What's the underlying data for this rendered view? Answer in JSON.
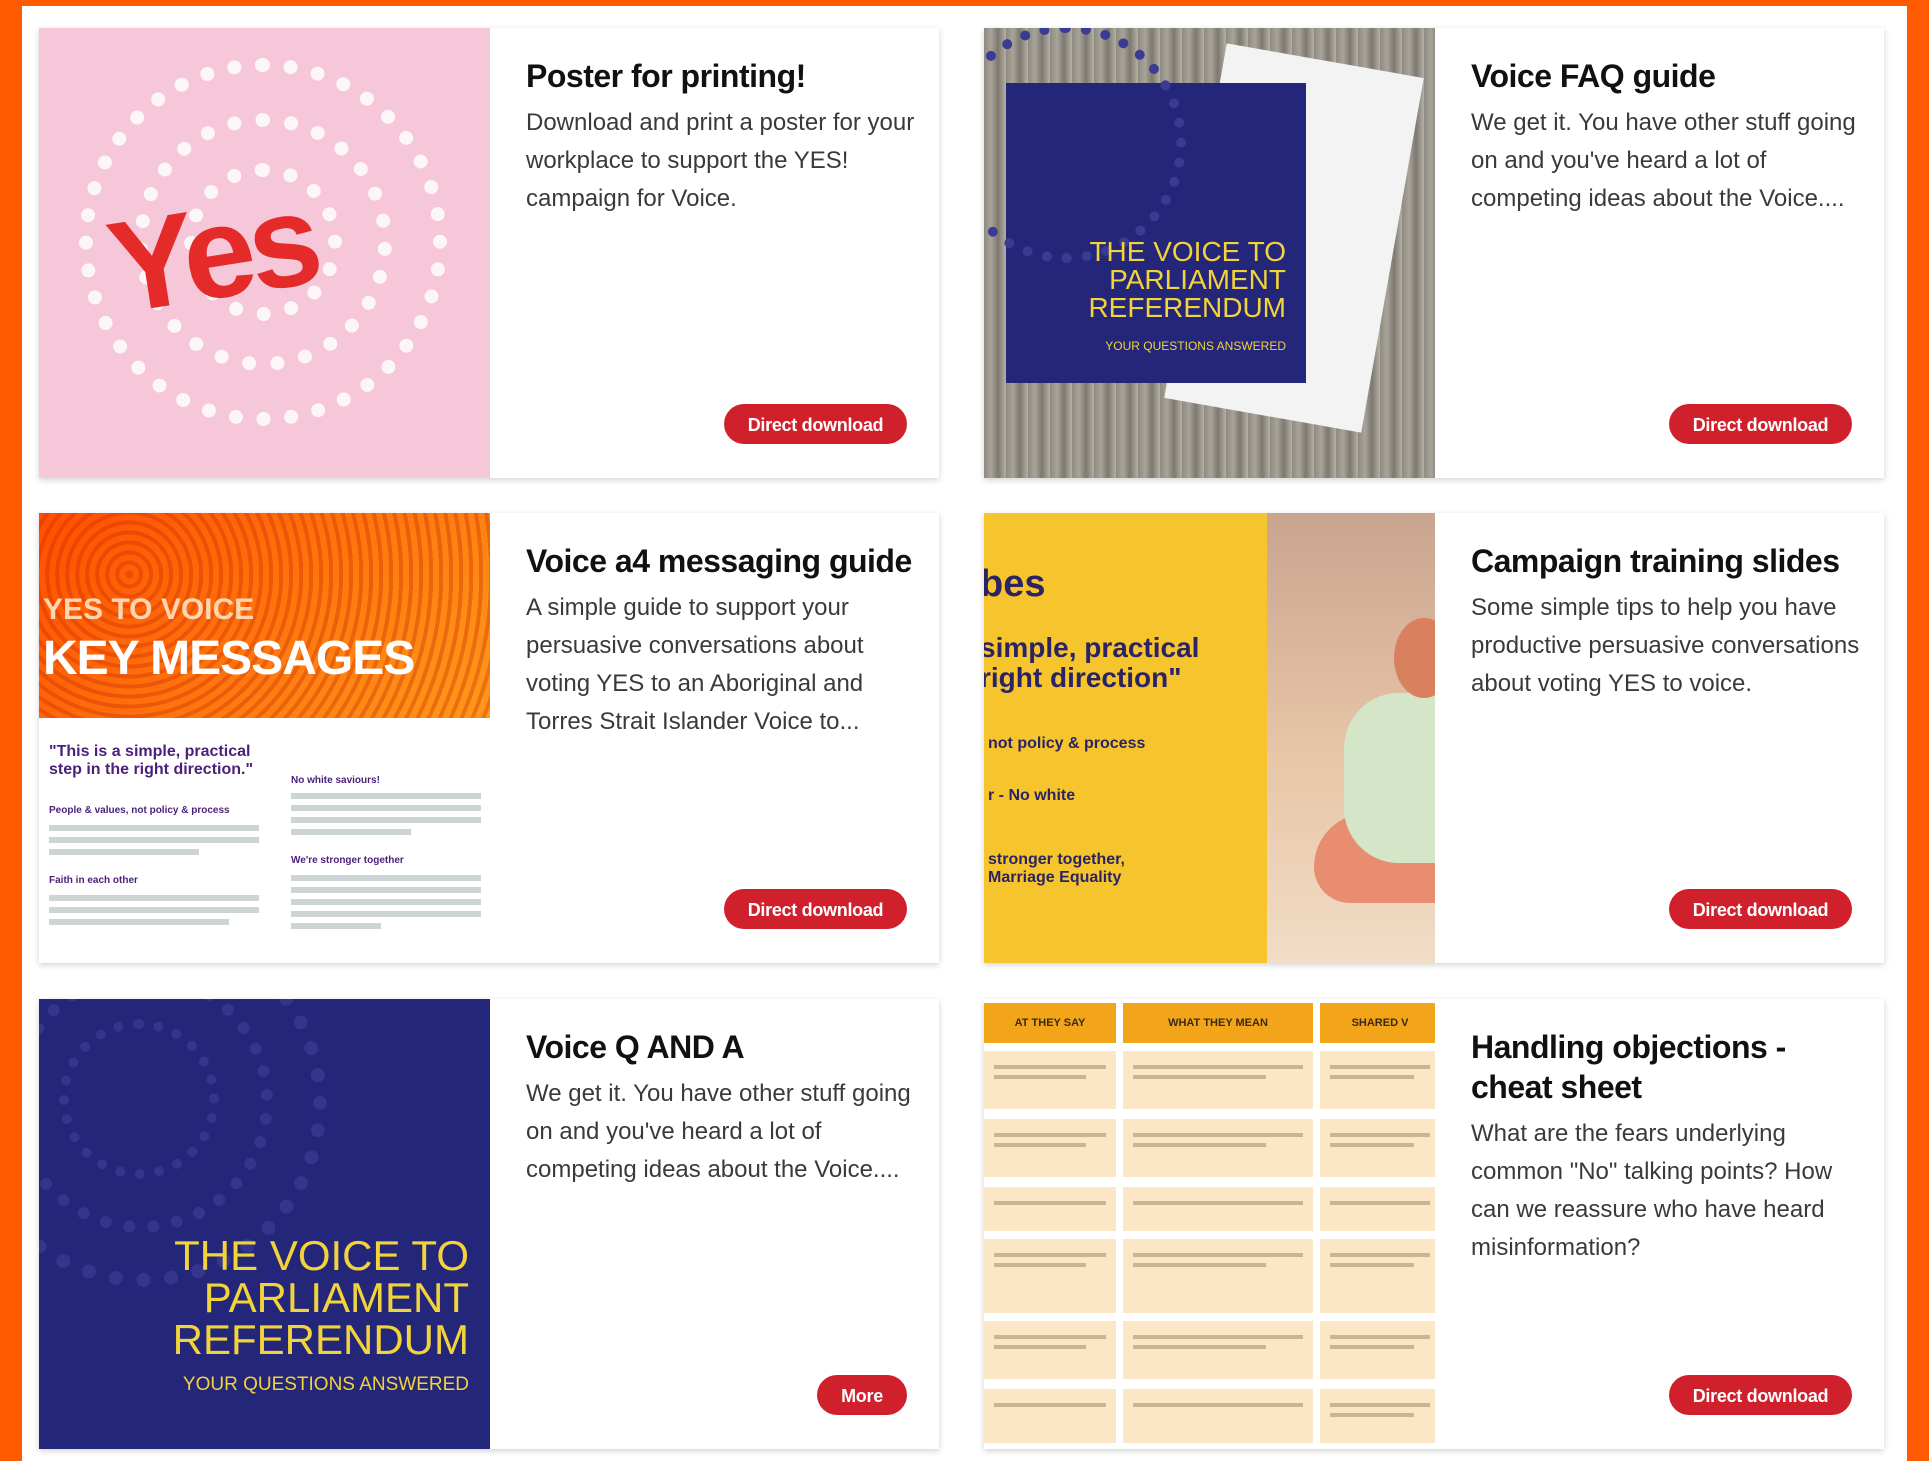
{
  "cards": [
    {
      "title": "Poster for printing!",
      "description": "Download and print a poster for your workplace to support the YES! campaign for Voice.",
      "button": "Direct download",
      "thumb_text": "Yes"
    },
    {
      "title": "Voice FAQ guide",
      "description": "We get it. You have other stuff going on and you've heard a lot of competing ideas about the Voice....",
      "button": "Direct download",
      "thumb_title": "THE VOICE TO PARLIAMENT REFERENDUM",
      "thumb_sub": "YOUR QUESTIONS ANSWERED"
    },
    {
      "title": "Voice a4 messaging guide",
      "description": "A simple guide to support your persuasive conversations about voting YES to an Aboriginal and Torres Strait Islander Voice to...",
      "button": "Direct download",
      "thumb_line1": "YES TO VOICE",
      "thumb_line2": "KEY MESSAGES",
      "thumb_quote": "\"This is a simple, practical step in the right direction.\"",
      "thumb_h1": "No white saviours!",
      "thumb_h2": "People & values, not policy & process",
      "thumb_h3": "We're stronger together",
      "thumb_h4": "Faith in each other"
    },
    {
      "title": "Campaign training slides",
      "description": "Some simple tips to help you have productive persuasive conversations about voting YES to voice.",
      "button": "Direct download",
      "thumb_l1": "bes",
      "thumb_l2": "simple, practical right direction\"",
      "thumb_l3": "not policy & process",
      "thumb_l4": "r - No white",
      "thumb_l5": "stronger together, Marriage Equality"
    },
    {
      "title": "Voice Q AND A",
      "description": "We get it. You have other stuff going on and you've heard a lot of competing ideas about the Voice....",
      "button": "More",
      "thumb_title": "THE VOICE TO PARLIAMENT REFERENDUM",
      "thumb_sub": "YOUR QUESTIONS ANSWERED"
    },
    {
      "title": "Handling objections - cheat sheet",
      "description": "What are the fears underlying common \"No\" talking points? How can we reassure who have heard misinformation?",
      "button": "Direct download",
      "thumb_col1": "AT THEY SAY",
      "thumb_col2": "WHAT THEY MEAN",
      "thumb_col3": "SHARED V"
    }
  ]
}
